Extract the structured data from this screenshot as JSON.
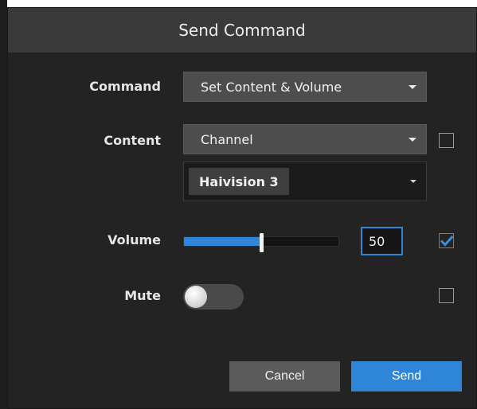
{
  "dialog": {
    "title": "Send Command",
    "command": {
      "label": "Command",
      "value": "Set Content & Volume"
    },
    "content": {
      "label": "Content",
      "value": "Channel",
      "channel_value": "Haivision 3",
      "checked": false
    },
    "volume": {
      "label": "Volume",
      "value": "50",
      "level_percent": 50,
      "checked": true
    },
    "mute": {
      "label": "Mute",
      "on": false,
      "checked": false
    },
    "buttons": {
      "cancel": "Cancel",
      "send": "Send"
    }
  },
  "colors": {
    "accent": "#2f86d8",
    "dialog_bg": "#232323",
    "header_bg": "#3a3a3a"
  }
}
